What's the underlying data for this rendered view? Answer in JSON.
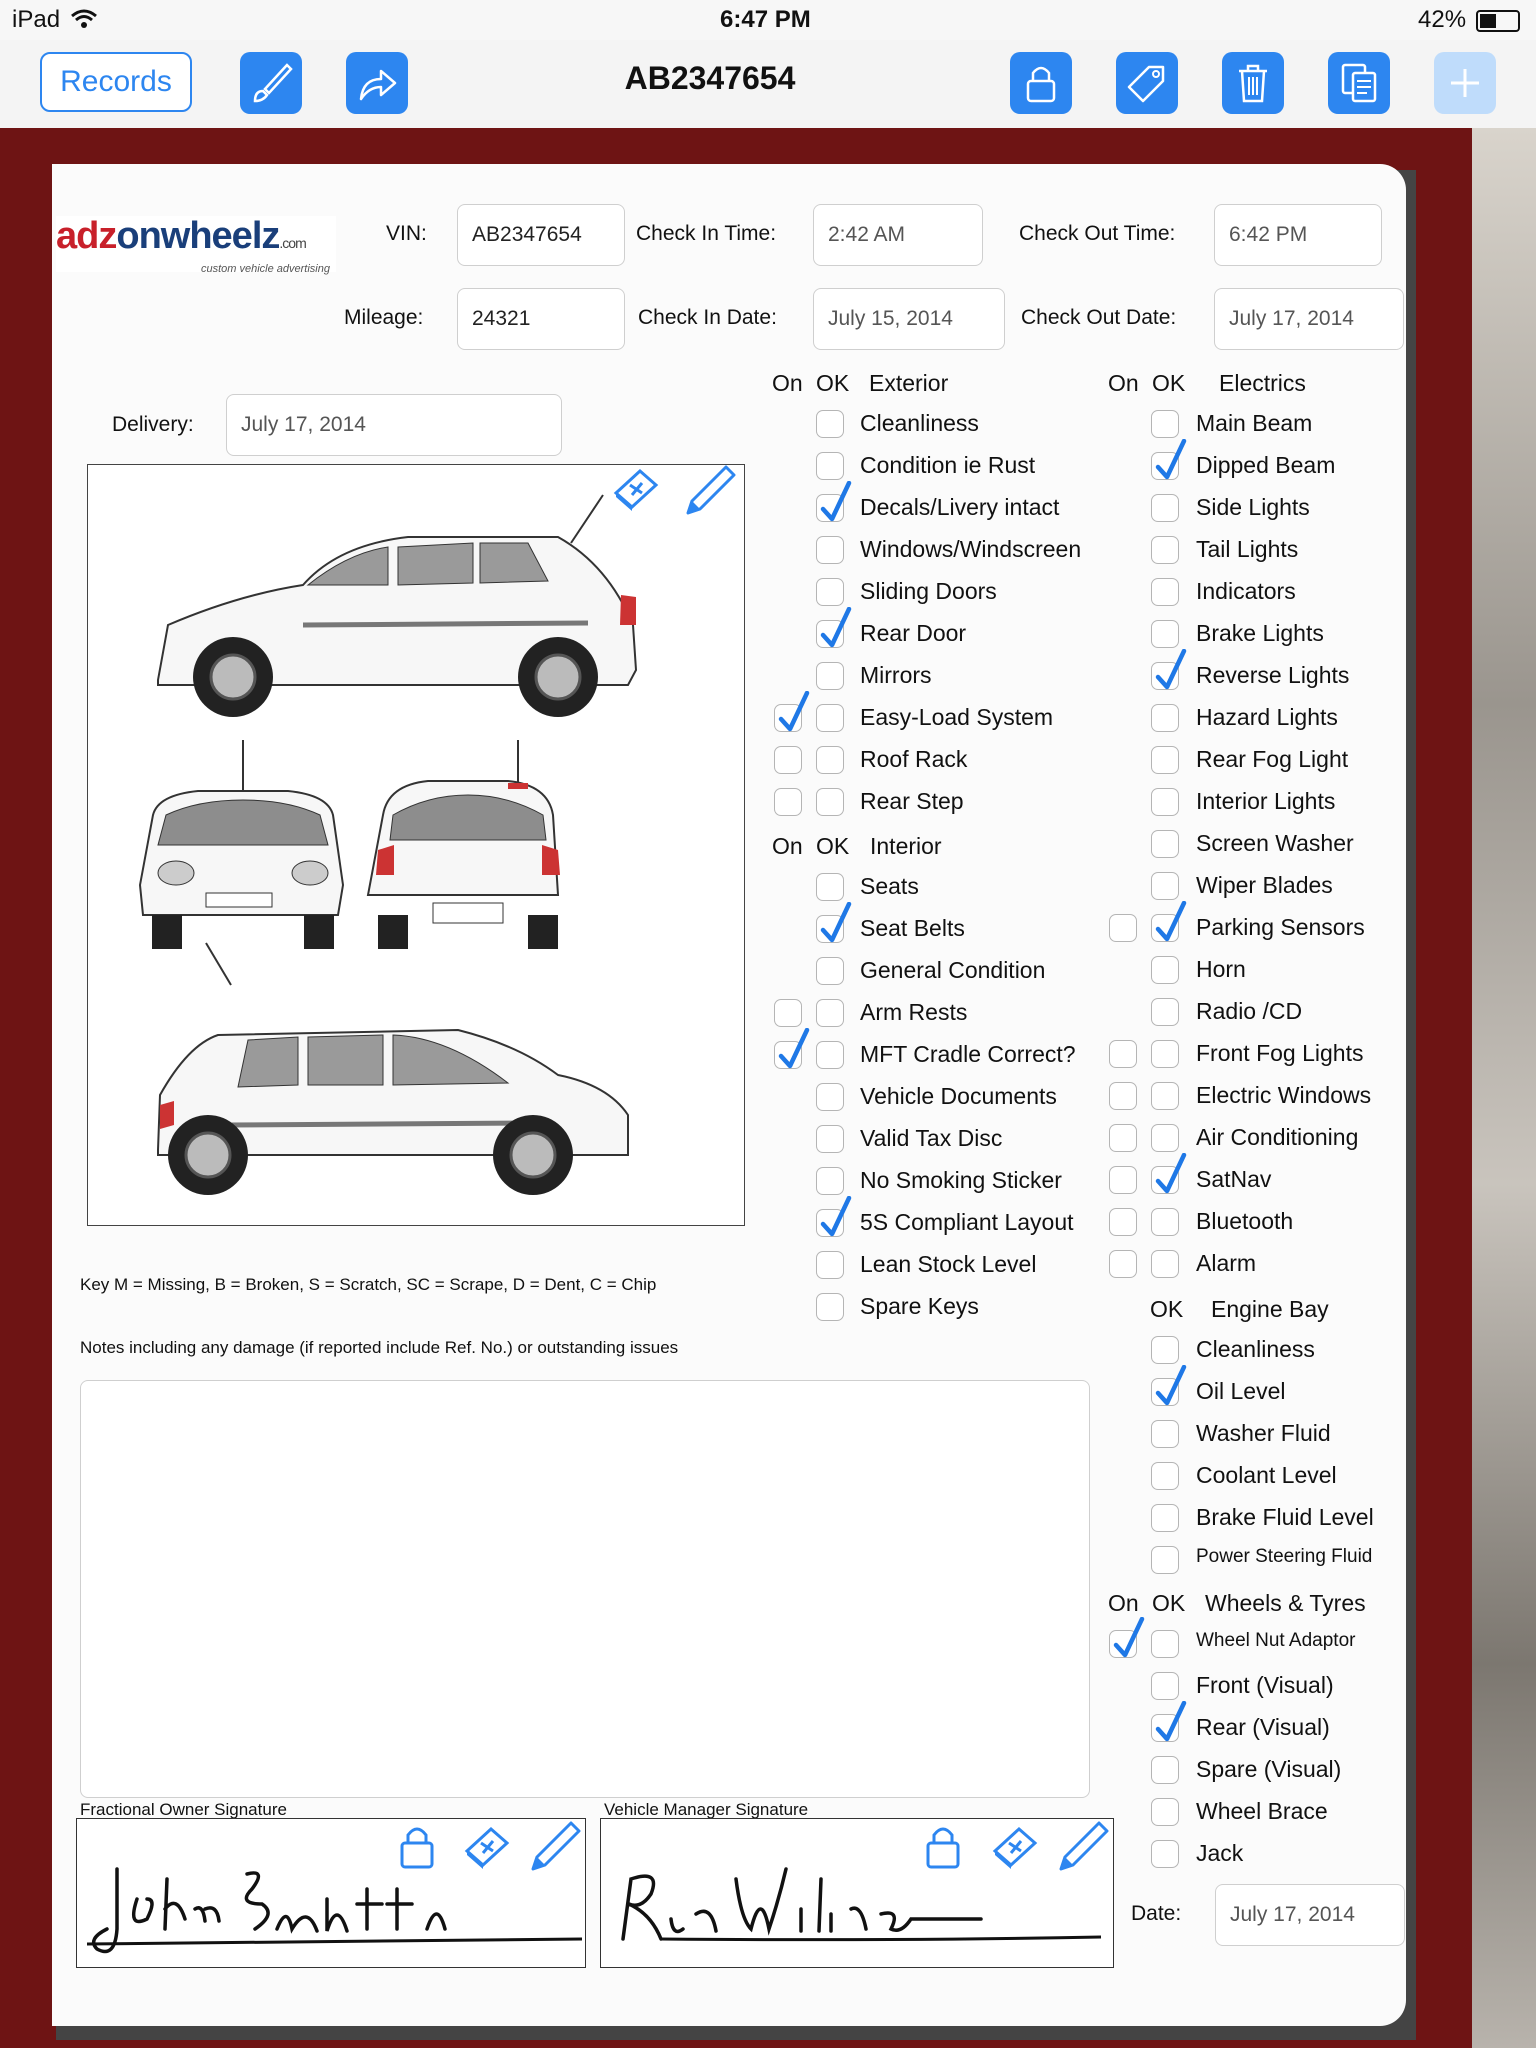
{
  "status": {
    "device": "iPad",
    "time": "6:47 PM",
    "battery": "42%"
  },
  "toolbar": {
    "records_label": "Records",
    "title": "AB2347654",
    "icons": [
      "brush-icon",
      "share-icon",
      "lock-icon",
      "tag-icon",
      "trash-icon",
      "copy-icon",
      "add-icon"
    ]
  },
  "logo": {
    "brand": "adzonwheelz",
    "domain": ".com",
    "tagline": "custom vehicle advertising"
  },
  "form": {
    "vin_label": "VIN:",
    "vin": "AB2347654",
    "checkin_time_label": "Check In Time:",
    "checkin_time": "2:42 AM",
    "checkout_time_label": "Check Out Time:",
    "checkout_time": "6:42 PM",
    "mileage_label": "Mileage:",
    "mileage": "24321",
    "checkin_date_label": "Check In Date:",
    "checkin_date": "July 15, 2014",
    "checkout_date_label": "Check Out Date:",
    "checkout_date": "July 17, 2014",
    "delivery_label": "Delivery:",
    "delivery": "July 17, 2014",
    "key_text": "Key   M = Missing, B = Broken, S = Scratch, SC = Scrape, D = Dent, C = Chip",
    "notes_label": "Notes including any damage (if reported include Ref. No.) or outstanding issues",
    "owner_sig_label": "Fractional Owner Signature",
    "manager_sig_label": "Vehicle Manager Signature",
    "date_label": "Date:",
    "date": "July 17, 2014"
  },
  "headers": {
    "on": "On",
    "ok": "OK",
    "exterior": "Exterior",
    "electrics": "Electrics",
    "interior": "Interior",
    "engine_bay": "Engine Bay",
    "wheels": "Wheels & Tyres"
  },
  "exterior": [
    {
      "label": "Cleanliness",
      "on": null,
      "ok": false
    },
    {
      "label": "Condition ie Rust",
      "on": null,
      "ok": false
    },
    {
      "label": "Decals/Livery intact",
      "on": null,
      "ok": true
    },
    {
      "label": "Windows/Windscreen",
      "on": null,
      "ok": false
    },
    {
      "label": "Sliding Doors",
      "on": null,
      "ok": false
    },
    {
      "label": "Rear Door",
      "on": null,
      "ok": true
    },
    {
      "label": "Mirrors",
      "on": null,
      "ok": false
    },
    {
      "label": "Easy-Load System",
      "on": true,
      "ok": false
    },
    {
      "label": "Roof Rack",
      "on": false,
      "ok": false
    },
    {
      "label": "Rear Step",
      "on": false,
      "ok": false
    }
  ],
  "interior": [
    {
      "label": "Seats",
      "on": null,
      "ok": false
    },
    {
      "label": "Seat Belts",
      "on": null,
      "ok": true
    },
    {
      "label": "General Condition",
      "on": null,
      "ok": false
    },
    {
      "label": "Arm Rests",
      "on": false,
      "ok": false
    },
    {
      "label": "MFT Cradle Correct?",
      "on": true,
      "ok": false
    },
    {
      "label": "Vehicle Documents",
      "on": null,
      "ok": false
    },
    {
      "label": "Valid Tax Disc",
      "on": null,
      "ok": false
    },
    {
      "label": "No Smoking Sticker",
      "on": null,
      "ok": false
    },
    {
      "label": "5S Compliant Layout",
      "on": null,
      "ok": true
    },
    {
      "label": "Lean Stock Level",
      "on": null,
      "ok": false
    },
    {
      "label": "Spare Keys",
      "on": null,
      "ok": false
    }
  ],
  "electrics": [
    {
      "label": "Main Beam",
      "on": null,
      "ok": false
    },
    {
      "label": "Dipped Beam",
      "on": null,
      "ok": true
    },
    {
      "label": "Side Lights",
      "on": null,
      "ok": false
    },
    {
      "label": "Tail Lights",
      "on": null,
      "ok": false
    },
    {
      "label": "Indicators",
      "on": null,
      "ok": false
    },
    {
      "label": "Brake Lights",
      "on": null,
      "ok": false
    },
    {
      "label": "Reverse Lights",
      "on": null,
      "ok": true
    },
    {
      "label": "Hazard Lights",
      "on": null,
      "ok": false
    },
    {
      "label": "Rear Fog Light",
      "on": null,
      "ok": false
    },
    {
      "label": "Interior Lights",
      "on": null,
      "ok": false
    },
    {
      "label": "Screen Washer",
      "on": null,
      "ok": false
    },
    {
      "label": "Wiper Blades",
      "on": null,
      "ok": false
    },
    {
      "label": "Parking Sensors",
      "on": false,
      "ok": true
    },
    {
      "label": "Horn",
      "on": null,
      "ok": false
    },
    {
      "label": "Radio /CD",
      "on": null,
      "ok": false
    },
    {
      "label": "Front Fog Lights",
      "on": false,
      "ok": false
    },
    {
      "label": "Electric Windows",
      "on": false,
      "ok": false
    },
    {
      "label": "Air Conditioning",
      "on": false,
      "ok": false
    },
    {
      "label": "SatNav",
      "on": false,
      "ok": true
    },
    {
      "label": "Bluetooth",
      "on": false,
      "ok": false
    },
    {
      "label": "Alarm",
      "on": false,
      "ok": false
    }
  ],
  "engine_bay": [
    {
      "label": "Cleanliness",
      "ok": false
    },
    {
      "label": "Oil Level",
      "ok": true
    },
    {
      "label": "Washer Fluid",
      "ok": false
    },
    {
      "label": "Coolant Level",
      "ok": false
    },
    {
      "label": "Brake Fluid Level",
      "ok": false
    },
    {
      "label": "Power Steering Fluid",
      "ok": false
    }
  ],
  "wheels": [
    {
      "label": "Wheel Nut Adaptor",
      "on": true,
      "ok": false
    },
    {
      "label": "Front (Visual)",
      "on": null,
      "ok": false
    },
    {
      "label": "Rear (Visual)",
      "on": null,
      "ok": true
    },
    {
      "label": "Spare (Visual)",
      "on": null,
      "ok": false
    },
    {
      "label": "Wheel Brace",
      "on": null,
      "ok": false
    },
    {
      "label": "Jack",
      "on": null,
      "ok": false
    }
  ],
  "colors": {
    "accent": "#2d86f0",
    "background": "#6e1414"
  }
}
